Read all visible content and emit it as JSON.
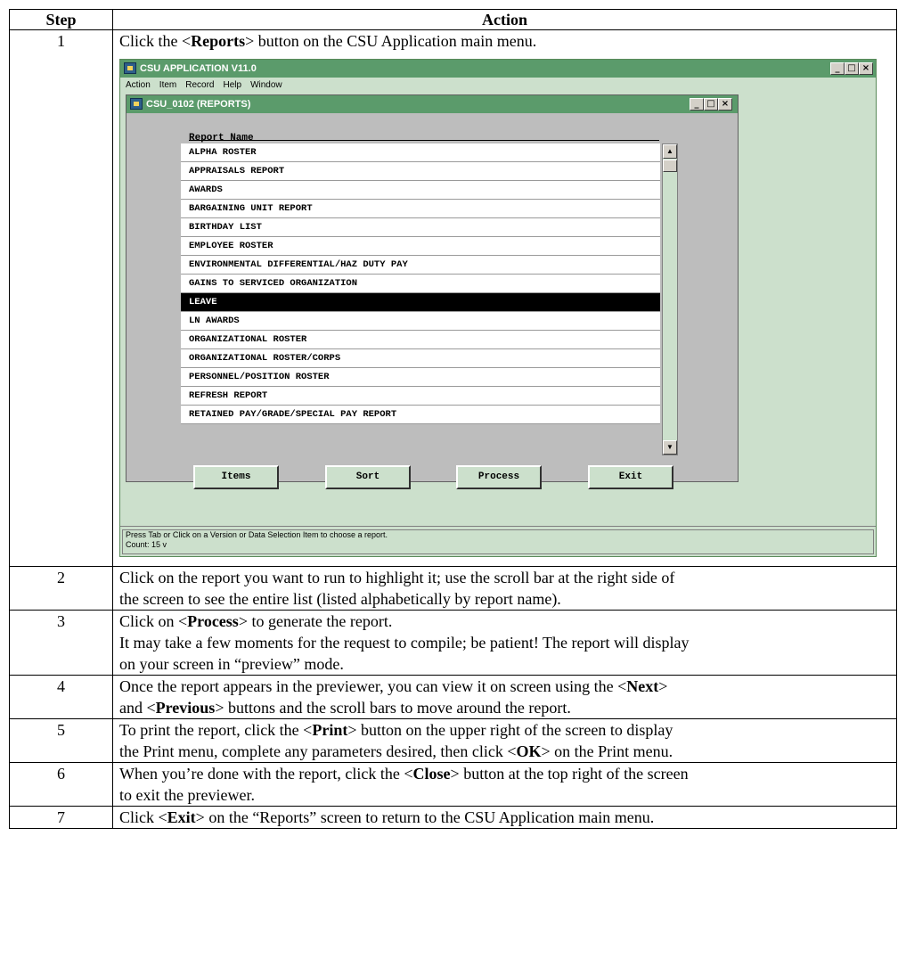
{
  "header": {
    "step": "Step",
    "action": "Action"
  },
  "steps": [
    {
      "num": "1",
      "lines": [
        {
          "pre": "Click the <",
          "bold": "Reports",
          "post": "> button on the CSU Application main menu."
        }
      ]
    },
    {
      "num": "2",
      "lines": [
        {
          "pre": "Click on the report you want to run to highlight it; use the scroll bar at the right side of"
        },
        {
          "pre": "the screen to see the entire list (listed alphabetically by report name)."
        }
      ]
    },
    {
      "num": "3",
      "lines": [
        {
          "pre": "Click on <",
          "bold": "Process",
          "post": "> to generate the report."
        },
        {
          "pre": "It may take a few moments for the request to compile; be patient!  The report will display"
        },
        {
          "pre": "on your screen in “preview” mode."
        }
      ]
    },
    {
      "num": "4",
      "lines": [
        {
          "pre": "Once the report appears in the previewer, you can view it on screen using the <",
          "bold": "Next",
          "post": ">"
        },
        {
          "pre": "and <",
          "bold": "Previous",
          "post": "> buttons and the scroll bars to move around the report."
        }
      ]
    },
    {
      "num": "5",
      "lines": [
        {
          "pre": "To print the report, click the <",
          "bold": "Print",
          "post": "> button on the upper right of the screen to display"
        },
        {
          "pre": "the Print menu, complete any parameters desired, then click <",
          "bold": "OK",
          "post": "> on the Print menu."
        }
      ]
    },
    {
      "num": "6",
      "lines": [
        {
          "pre": "When you’re done with the report, click the <",
          "bold": "Close",
          "post": "> button at the top right of the screen"
        },
        {
          "pre": "to exit the previewer."
        }
      ]
    },
    {
      "num": "7",
      "lines": [
        {
          "pre": "Click <",
          "bold": "Exit",
          "post": "> on the “Reports” screen to return to the CSU Application main menu."
        }
      ]
    }
  ],
  "app": {
    "title": "CSU APPLICATION V11.0",
    "menu": [
      "Action",
      "Item",
      "Record",
      "Help",
      "Window"
    ],
    "child_title": "CSU_0102 (REPORTS)",
    "list_header": "Report Name",
    "reports": [
      "ALPHA ROSTER",
      "APPRAISALS REPORT",
      "AWARDS",
      "BARGAINING UNIT REPORT",
      "BIRTHDAY LIST",
      "EMPLOYEE ROSTER",
      "ENVIRONMENTAL DIFFERENTIAL/HAZ DUTY PAY",
      "GAINS TO SERVICED ORGANIZATION",
      "LEAVE",
      "LN AWARDS",
      "ORGANIZATIONAL ROSTER",
      "ORGANIZATIONAL ROSTER/CORPS",
      "PERSONNEL/POSITION ROSTER",
      "REFRESH REPORT",
      "RETAINED PAY/GRADE/SPECIAL PAY REPORT"
    ],
    "selected_index": 8,
    "buttons": {
      "items": "Items",
      "sort": "Sort",
      "process": "Process",
      "exit": "Exit"
    },
    "status_line1": "Press Tab or Click on a Version or Data Selection Item to choose a report.",
    "status_line2": "Count: 15       v"
  }
}
